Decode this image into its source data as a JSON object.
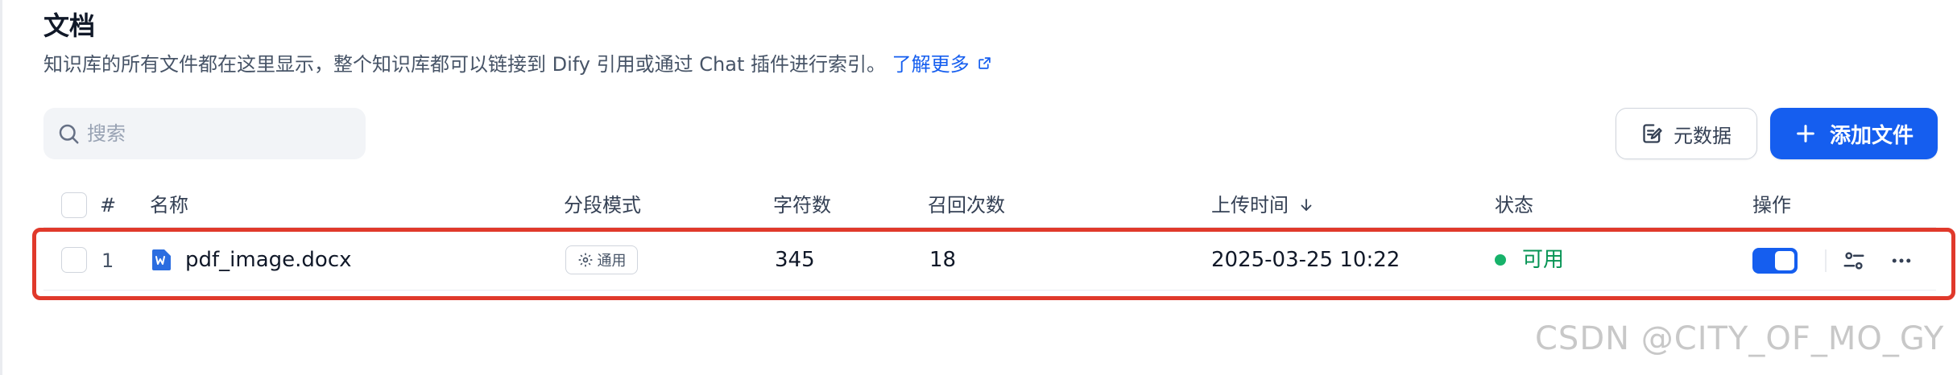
{
  "header": {
    "title": "文档",
    "description": "知识库的所有文件都在这里显示，整个知识库都可以链接到 Dify 引用或通过 Chat 插件进行索引。",
    "learn_more": "了解更多"
  },
  "toolbar": {
    "search_placeholder": "搜索",
    "metadata_label": "元数据",
    "add_file_label": "添加文件"
  },
  "table": {
    "columns": {
      "index": "#",
      "name": "名称",
      "chunk_mode": "分段模式",
      "chars": "字符数",
      "recall": "召回次数",
      "upload_time": "上传时间",
      "status": "状态",
      "actions": "操作"
    },
    "rows": [
      {
        "index": "1",
        "name": "pdf_image.docx",
        "chunk_mode": "通用",
        "chars": "345",
        "recall": "18",
        "upload_time": "2025-03-25 10:22",
        "status": "可用",
        "enabled": true
      }
    ]
  },
  "watermark": "CSDN @CITY_OF_MO_GY",
  "colors": {
    "accent": "#155eef",
    "status_ok": "#17b26a",
    "highlight": "#e0392b"
  },
  "icons": {
    "search": "search-icon",
    "metadata": "metadata-icon",
    "add": "plus-icon",
    "file": "word-doc-icon",
    "mode": "gear-icon",
    "settings": "sliders-icon",
    "more": "more-icon",
    "external": "external-link-icon",
    "sort": "arrow-down-icon"
  }
}
